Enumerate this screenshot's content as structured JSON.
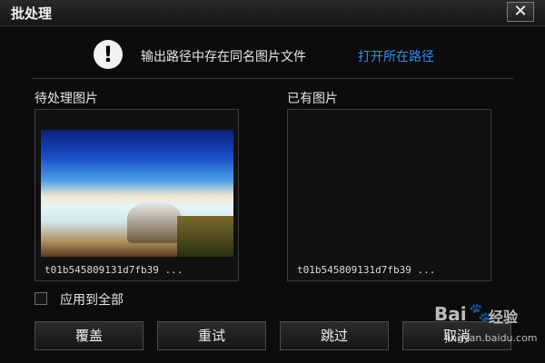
{
  "window": {
    "title": "批处理",
    "close_label": "✕"
  },
  "notice": {
    "icon": "exclamation-icon",
    "text": "输出路径中存在同名图片文件",
    "link": "打开所在路径",
    "link_color": "#2f8ef5"
  },
  "pending": {
    "label": "待处理图片",
    "filename": "t01b545809131d7fb39 ..."
  },
  "existing": {
    "label": "已有图片",
    "filename": "t01b545809131d7fb39 ..."
  },
  "apply_all": {
    "label": "应用到全部",
    "checked": false
  },
  "buttons": {
    "overwrite": "覆盖",
    "retry": "重试",
    "skip": "跳过",
    "cancel": "取消"
  },
  "watermark": {
    "brand": "Bai",
    "brand_tail": "经验",
    "url": "jingyan.baidu.com"
  }
}
